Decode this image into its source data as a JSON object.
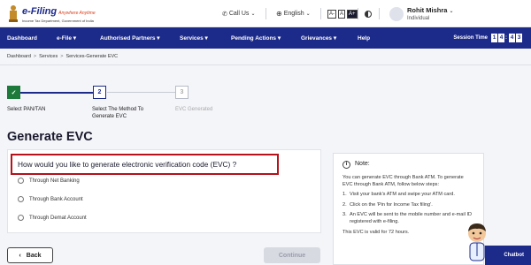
{
  "brand": {
    "title": "e-Filing",
    "tagline": "Anywhere Anytime",
    "subtitle": "Income Tax Department, Government of India"
  },
  "topbar": {
    "call_us": "Call Us",
    "language": "English",
    "font_small": "A-",
    "font_normal": "A",
    "font_large": "A+",
    "user_name": "Rohit Mishra",
    "user_role": "Individual"
  },
  "nav": {
    "items": [
      "Dashboard",
      "e-File ▾",
      "Authorised Partners ▾",
      "Services ▾",
      "Pending Actions ▾",
      "Grievances ▾",
      "Help"
    ],
    "session_label": "Session Time",
    "session_digits": [
      "1",
      "4",
      ":",
      "4",
      "3"
    ]
  },
  "breadcrumb": [
    "Dashboard",
    "Services",
    "Services-Generate EVC"
  ],
  "stepper": {
    "steps": [
      {
        "number": "✓",
        "label": "Select PAN/TAN"
      },
      {
        "number": "2",
        "label": "Select The Method To Generate EVC"
      },
      {
        "number": "3",
        "label": "EVC Generated"
      }
    ]
  },
  "page_title": "Generate EVC",
  "question": "How would you like to generate electronic verification code (EVC) ?",
  "options": [
    "Through Net Banking",
    "Through Bank Account",
    "Through Demat Account"
  ],
  "note": {
    "heading": "Note:",
    "intro": "You can generate EVC through Bank ATM. To generate EVC through Bank ATM, follow below steps:",
    "steps": [
      "Visit your bank's ATM and swipe your ATM card.",
      "Click on the 'Pin for Income Tax filing'.",
      "An EVC will be sent to the mobile number and e-mail ID registered with e-filing."
    ],
    "footer": "This EVC is valid for 72 hours."
  },
  "buttons": {
    "back": "Back",
    "continue": "Continue",
    "chatbot": "Chatbot"
  },
  "colors": {
    "primary": "#1c2a8a",
    "success": "#1d7a3a",
    "highlight": "#b5121b"
  }
}
